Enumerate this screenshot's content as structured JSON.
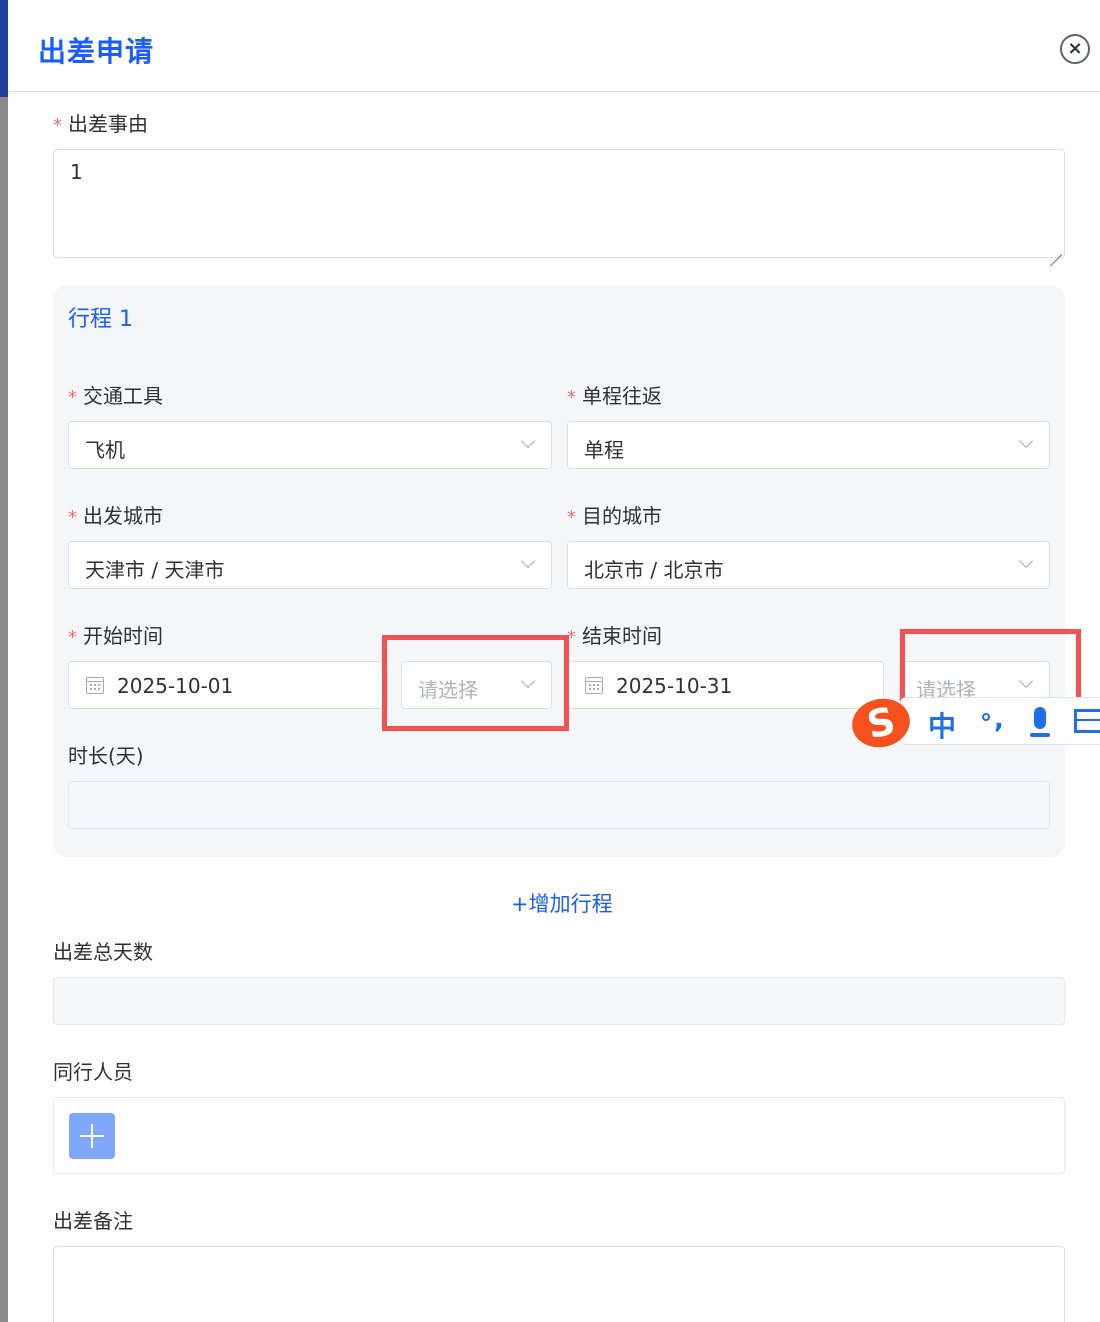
{
  "dialog": {
    "title": "出差申请",
    "close_glyph": "×"
  },
  "reason": {
    "required": "*",
    "label": "出差事由",
    "value": "1"
  },
  "trip": {
    "title": "行程 1",
    "transport": {
      "required": "*",
      "label": "交通工具",
      "value": "飞机"
    },
    "trip_type": {
      "required": "*",
      "label": "单程往返",
      "value": "单程"
    },
    "from_city": {
      "required": "*",
      "label": "出发城市",
      "value": "天津市 / 天津市"
    },
    "to_city": {
      "required": "*",
      "label": "目的城市",
      "value": "北京市 / 北京市"
    },
    "start": {
      "required": "*",
      "label": "开始时间",
      "date": "2025-10-01",
      "period_placeholder": "请选择"
    },
    "end": {
      "required": "*",
      "label": "结束时间",
      "date": "2025-10-31",
      "period_placeholder": "请选择"
    },
    "duration": {
      "label": "时长(天)",
      "value": ""
    }
  },
  "add_trip_label": "+增加行程",
  "total_days": {
    "label": "出差总天数",
    "value": ""
  },
  "companions": {
    "label": "同行人员"
  },
  "remarks": {
    "label": "出差备注",
    "value": ""
  },
  "ime_toolbar": {
    "logo": "S",
    "mode": "中",
    "punct": ","
  },
  "colors": {
    "primary": "#1a5cff",
    "required": "#f56c6c",
    "highlight": "#f25252",
    "ime_logo": "#f5511e",
    "ime_blue": "#1e6fe8"
  }
}
